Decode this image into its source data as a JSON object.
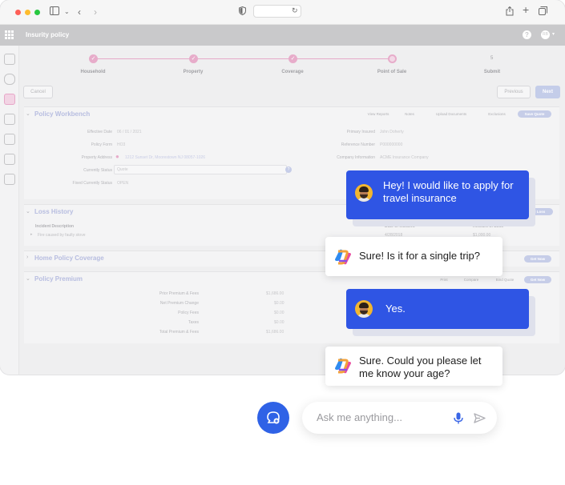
{
  "app": {
    "title": "Insurity policy",
    "user_initials": "RB"
  },
  "steps": [
    {
      "label": "Household",
      "state": "done"
    },
    {
      "label": "Property",
      "state": "done"
    },
    {
      "label": "Coverage",
      "state": "done"
    },
    {
      "label": "Point of Sale",
      "state": "current"
    },
    {
      "label": "Submit",
      "state": "pending",
      "number": "5"
    }
  ],
  "toolbar": {
    "cancel_label": "Cancel",
    "previous_label": "Previous",
    "next_label": "Next"
  },
  "workbench": {
    "title": "Policy Workbench",
    "actions": [
      "View Reports",
      "Notes",
      "Upload Documents",
      "Exclusions"
    ],
    "primary_action": "Save Quote",
    "left_fields": [
      {
        "label": "Effective Date",
        "value": "06 / 01 / 2021"
      },
      {
        "label": "Policy Form",
        "value": "HO3"
      },
      {
        "label": "Property Address",
        "value": "1212 Sunset Dr, Moorestown NJ 08057-1026"
      },
      {
        "label": "Currently Status",
        "value": "Quote"
      },
      {
        "label": "Fixed Currently Status",
        "value": "OPEN"
      }
    ],
    "right_fields": [
      {
        "label": "Primary Insured",
        "value": "John Doherty"
      },
      {
        "label": "Reference Number",
        "value": "P000000000"
      },
      {
        "label": "Company Information",
        "value": "ACME Insurance Company"
      }
    ]
  },
  "loss_history": {
    "title": "Loss History",
    "action": "Add Loss",
    "columns": [
      "Incident Description",
      "Date of Incident",
      "Amount of Loss"
    ],
    "rows": [
      [
        "Fire caused by faulty stove",
        "4/28/2018",
        "$1,000.00"
      ]
    ]
  },
  "home_coverage": {
    "title": "Home Policy Coverage",
    "action": "Get Now"
  },
  "premium": {
    "title": "Policy Premium",
    "actions": [
      "Print",
      "Compare",
      "Bind Quote"
    ],
    "primary_action": "Get Now",
    "rows": [
      {
        "label": "Prior Premium & Fees",
        "value": "$1,686.00"
      },
      {
        "label": "Net Premium Change",
        "value": "$0.00"
      },
      {
        "label": "Policy Fees",
        "value": "$0.00"
      },
      {
        "label": "Taxes",
        "value": "$0.00"
      },
      {
        "label": "Total Premium & Fees",
        "value": "$1,686.00"
      }
    ]
  },
  "chat": {
    "messages": [
      {
        "from": "user",
        "text": "Hey! I would like to apply for travel insurance"
      },
      {
        "from": "bot",
        "text": "Sure! Is it for a single trip?"
      },
      {
        "from": "user",
        "text": "Yes."
      },
      {
        "from": "bot",
        "text": "Sure. Could you please let me know your age?"
      }
    ],
    "input_placeholder": "Ask me anything..."
  },
  "colors": {
    "accent": "#2F55E4",
    "step_pink": "#E7ACCA",
    "fab_blue": "#2F62E6"
  }
}
